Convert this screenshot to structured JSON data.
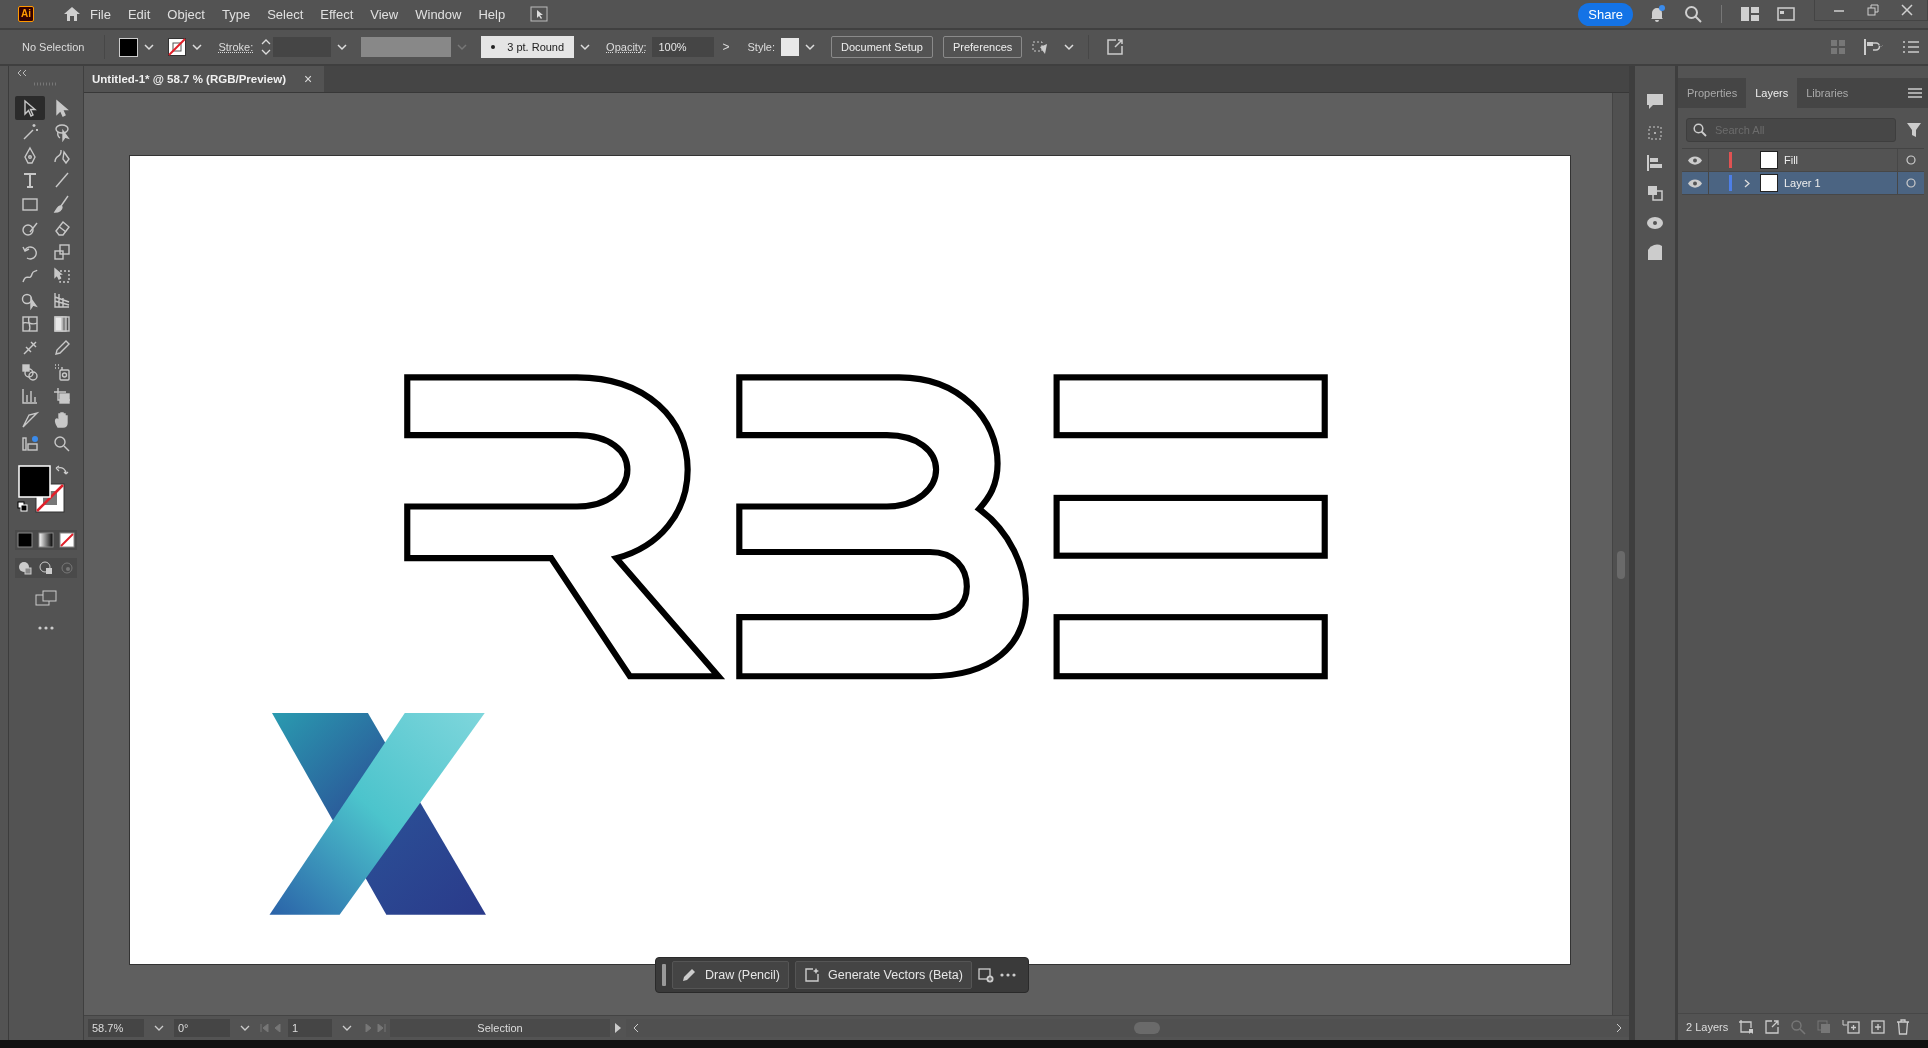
{
  "menubar": {
    "app_logo": "Ai",
    "menus": [
      "File",
      "Edit",
      "Object",
      "Type",
      "Select",
      "Effect",
      "View",
      "Window",
      "Help"
    ],
    "share": "Share"
  },
  "control_bar": {
    "selection": "No Selection",
    "stroke_label": "Stroke:",
    "brush": "3 pt. Round",
    "opacity_label": "Opacity:",
    "opacity": "100%",
    "opacity_arrow": ">",
    "style_label": "Style:",
    "buttons": [
      "Document Setup",
      "Preferences"
    ]
  },
  "tools": [
    {
      "selected": true
    },
    {
      "selected": false
    },
    {
      "selected": false
    },
    {
      "selected": false
    },
    {
      "selected": false
    },
    {
      "selected": false
    },
    {
      "selected": false
    },
    {
      "selected": false
    },
    {
      "selected": false
    },
    {
      "selected": false
    },
    {
      "selected": false
    },
    {
      "selected": false
    },
    {
      "selected": false
    },
    {
      "selected": false
    },
    {
      "selected": false
    },
    {
      "selected": false
    },
    {
      "selected": false
    },
    {
      "selected": false
    },
    {
      "selected": false
    },
    {
      "selected": false
    },
    {
      "selected": false
    },
    {
      "selected": false
    },
    {
      "selected": false
    },
    {
      "selected": false
    },
    {
      "selected": false
    },
    {
      "selected": false
    },
    {
      "selected": false
    },
    {
      "selected": false
    },
    {
      "selected": false
    },
    {
      "selected": false
    }
  ],
  "document_tab": {
    "title": "Untitled-1* @ 58.7 % (RGB/Preview)",
    "close": "×"
  },
  "floating_bar": {
    "buttons": [
      "Draw (Pencil)",
      "Generate Vectors (Beta)"
    ]
  },
  "status_bar": {
    "zoom": "58.7%",
    "rotation": "0°",
    "artboard": "1",
    "tool": "Selection"
  },
  "panel": {
    "tabs": [
      {
        "label": "Properties",
        "selected": false
      },
      {
        "label": "Layers",
        "selected": true
      },
      {
        "label": "Libraries",
        "selected": false
      }
    ],
    "search": {
      "placeholder": "Search All"
    },
    "layers": [
      {
        "name": "Fill",
        "color": "#e05252",
        "visible": true,
        "expandable": false,
        "selected": false
      },
      {
        "name": "Layer 1",
        "color": "#4d7fe8",
        "visible": true,
        "expandable": true,
        "selected": true
      }
    ],
    "count": "2 Layers"
  }
}
